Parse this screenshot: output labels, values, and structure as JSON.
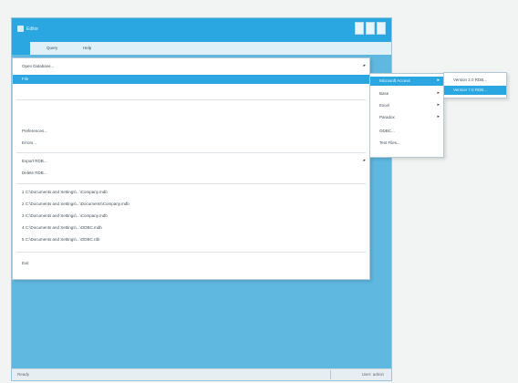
{
  "window": {
    "title": "Editor",
    "minimize_icon": "minimize-icon",
    "maximize_icon": "maximize-icon",
    "close_icon": "close-icon"
  },
  "menubar": {
    "items": [
      "",
      "Query",
      "Help"
    ]
  },
  "file_menu": {
    "items": [
      {
        "label": "Open Database...",
        "arrow": "▸"
      },
      {
        "label": "File"
      },
      {
        "label": "",
        "disabled": true
      },
      {
        "label": "",
        "disabled": true
      },
      {
        "label": "Preferences..."
      },
      {
        "label": "Errors..."
      },
      {
        "label": "Export RDB...",
        "arrow": "▸"
      },
      {
        "label": "Delete RDB..."
      },
      {
        "label": "1 C:\\Documents and Settings\\...\\Company.mdb"
      },
      {
        "label": "2 C:\\Documents and Settings\\...\\Documents\\Company.mdb"
      },
      {
        "label": "3 C:\\Documents and Settings\\...\\Company.mdb"
      },
      {
        "label": "4 C:\\Documents and Settings\\...\\ODBC.mdb"
      },
      {
        "label": "5 C:\\Documents and Settings\\...\\ODBC.rdb"
      },
      {
        "label": "Exit"
      }
    ]
  },
  "submenu1": {
    "items": [
      {
        "label": "Microsoft Access",
        "arrow": "▸"
      },
      {
        "label": "Base",
        "arrow": "▸"
      },
      {
        "label": "Excel",
        "arrow": "▸"
      },
      {
        "label": "Paradox",
        "arrow": "▸"
      },
      {
        "label": "ODBC..."
      },
      {
        "label": "Text Files..."
      }
    ]
  },
  "submenu2": {
    "items": [
      {
        "label": "Version 2.0 RDB..."
      },
      {
        "label": "Version 7.0 RDB..."
      }
    ]
  },
  "status": {
    "left": "Ready",
    "right": "User: admin"
  }
}
